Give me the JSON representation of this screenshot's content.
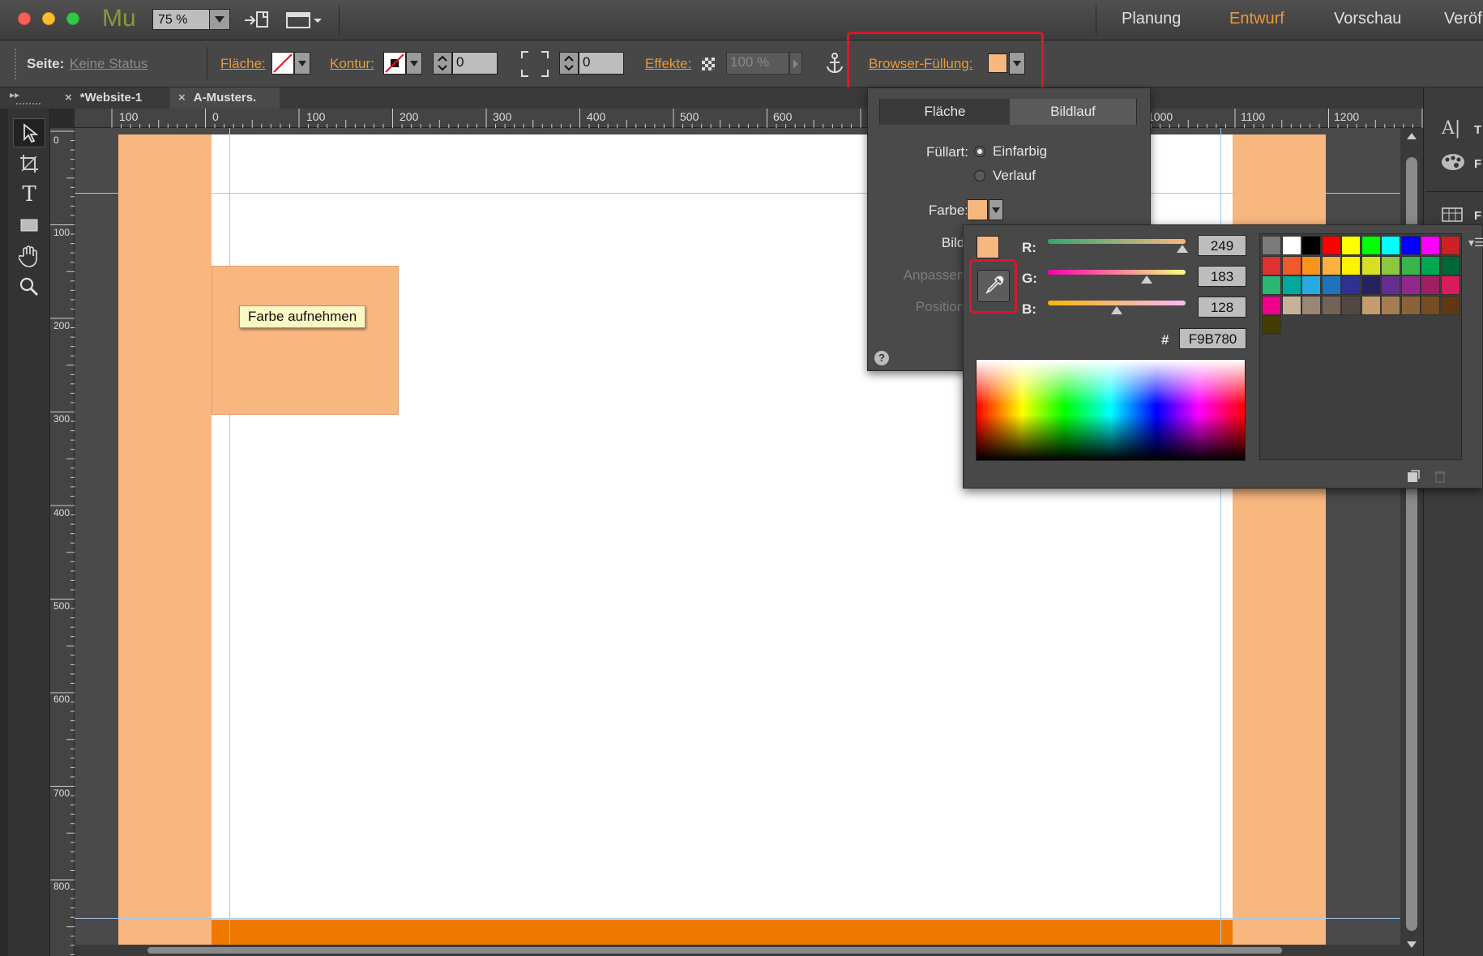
{
  "app": {
    "logo": "Mu",
    "zoom": "75 %",
    "modes": [
      "Planung",
      "Entwurf",
      "Vorschau",
      "Veröf"
    ],
    "active_mode": "Entwurf"
  },
  "control_bar": {
    "seite_label": "Seite:",
    "seite_value": "Keine Status",
    "flaeche_label": "Fläche:",
    "kontur_label": "Kontur:",
    "kontur_value": "0",
    "corner_value": "0",
    "effekte_label": "Effekte:",
    "opacity_value": "100 %",
    "browser_fill_label": "Browser-Füllung:"
  },
  "tabs": [
    "*Website-1",
    "A-Musters."
  ],
  "ruler": {
    "h_labels": [
      "100",
      "0",
      "100",
      "200",
      "300",
      "400",
      "500",
      "600",
      "1000",
      "1100",
      "1200"
    ],
    "v_labels": [
      "0",
      "100",
      "200",
      "300",
      "400",
      "500",
      "600",
      "700",
      "800"
    ]
  },
  "fill_panel": {
    "tab_flaeche": "Fläche",
    "tab_bildlauf": "Bildlauf",
    "fuellart_label": "Füllart:",
    "option_einfarbig": "Einfarbig",
    "option_verlauf": "Verlauf",
    "farbe_label": "Farbe:",
    "bild_label": "Bild:",
    "anpassen_label": "Anpassen:",
    "position_label": "Position:",
    "help": "?"
  },
  "color_picker": {
    "r_label": "R:",
    "g_label": "G:",
    "b_label": "B:",
    "r_value": "249",
    "g_value": "183",
    "b_value": "128",
    "hash_label": "#",
    "hex_value": "F9B780",
    "current_color": "#f9b780",
    "r_fraction": 0.976,
    "g_fraction": 0.718,
    "b_fraction": 0.502
  },
  "tooltip": "Farbe aufnehmen",
  "colors": {
    "accent_orange": "#e99a3c",
    "browser_fill": "#f9b780",
    "footer_bar": "#f07800",
    "highlight_red": "#e0142a"
  },
  "swatches": [
    "#7a7a7a",
    "#ffffff",
    "#000000",
    "#ff0000",
    "#ffff00",
    "#00ff00",
    "#00ffff",
    "#0000ff",
    "#ff00ff",
    "#cc2222",
    "#e03030",
    "#f05a28",
    "#f7941d",
    "#fbb040",
    "#fff200",
    "#d7df23",
    "#8dc63f",
    "#39b54a",
    "#00a651",
    "#006838",
    "#2bb673",
    "#00a99d",
    "#27aae1",
    "#1c75bc",
    "#2e3192",
    "#262262",
    "#662d91",
    "#92278f",
    "#9e1f63",
    "#d91c5c",
    "#ec008c",
    "#c7b299",
    "#998675",
    "#736357",
    "#534741",
    "#c69c6d",
    "#a67c52",
    "#8c6239",
    "#754c24",
    "#603913",
    "#423c00"
  ]
}
